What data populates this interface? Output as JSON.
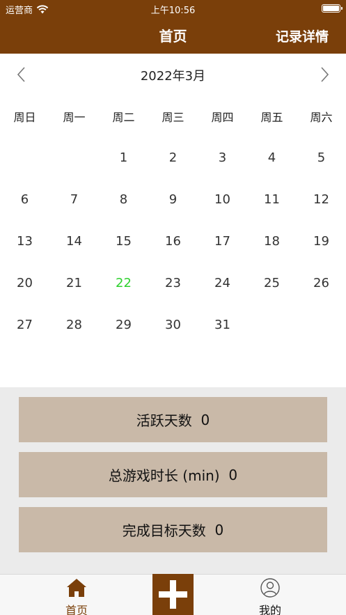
{
  "status_bar": {
    "carrier": "运营商",
    "time": "上午10:56"
  },
  "nav": {
    "title": "首页",
    "right_action": "记录详情"
  },
  "calendar": {
    "month_label": "2022年3月",
    "weekdays": [
      "周日",
      "周一",
      "周二",
      "周三",
      "周四",
      "周五",
      "周六"
    ],
    "days": [
      "",
      "",
      "1",
      "2",
      "3",
      "4",
      "5",
      "6",
      "7",
      "8",
      "9",
      "10",
      "11",
      "12",
      "13",
      "14",
      "15",
      "16",
      "17",
      "18",
      "19",
      "20",
      "21",
      "22",
      "23",
      "24",
      "25",
      "26",
      "27",
      "28",
      "29",
      "30",
      "31",
      "",
      ""
    ],
    "today": "22"
  },
  "stats": [
    {
      "label": "活跃天数",
      "value": "0"
    },
    {
      "label": "总游戏时长 (min)",
      "value": "0"
    },
    {
      "label": "完成目标天数",
      "value": "0"
    }
  ],
  "tabs": {
    "home_label": "首页",
    "mine_label": "我的"
  },
  "colors": {
    "brand": "#7a3f0a",
    "today": "#2ed12e",
    "card": "#c9b9a8"
  }
}
